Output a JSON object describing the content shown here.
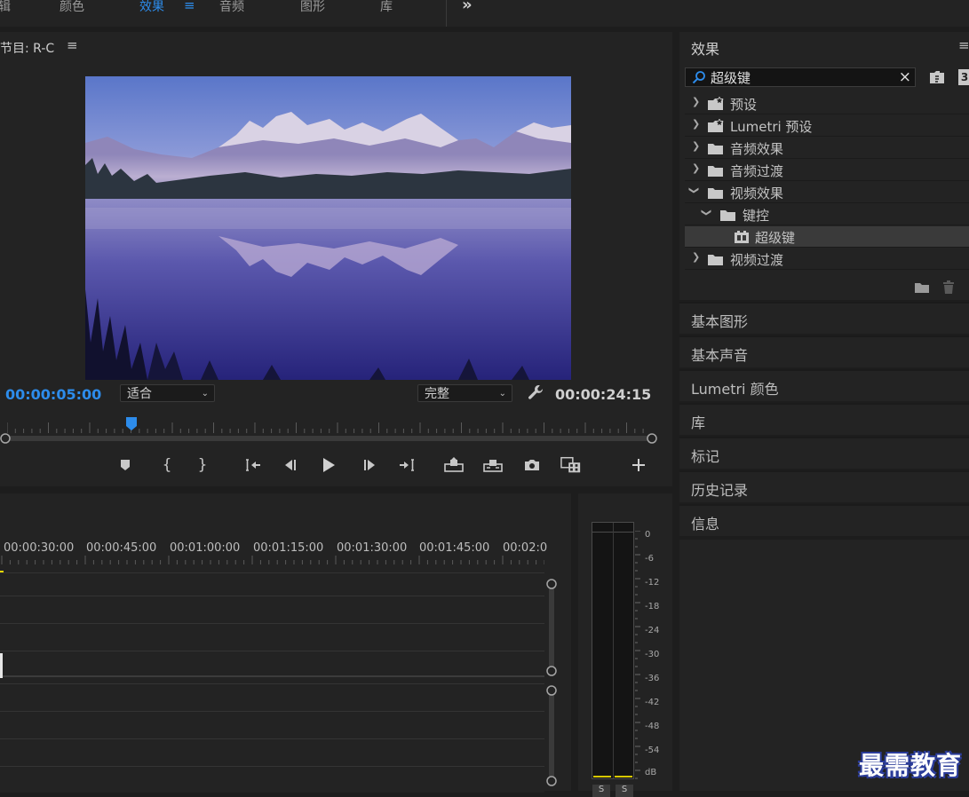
{
  "workspace_tabs": [
    {
      "label": "辑",
      "active": false
    },
    {
      "label": "颜色",
      "active": false
    },
    {
      "label": "效果",
      "active": true
    },
    {
      "label": "音频",
      "active": false
    },
    {
      "label": "图形",
      "active": false
    },
    {
      "label": "库",
      "active": false
    }
  ],
  "workspace_more": "»",
  "program_monitor": {
    "title": "节目: R-C",
    "menu": "≡",
    "current_timecode": "00:00:05:00",
    "zoom_value": "适合",
    "quality_value": "完整",
    "duration_timecode": "00:00:24:15",
    "playhead_fraction": 0.193
  },
  "transport_icons": [
    "add-marker-icon",
    "mark-in-icon",
    "mark-out-icon",
    "go-to-in-icon",
    "step-back-icon",
    "play-icon",
    "step-forward-icon",
    "go-to-out-icon",
    "lift-icon",
    "extract-icon",
    "export-frame-icon",
    "comparison-view-icon",
    "add-button-icon"
  ],
  "timeline": {
    "timecodes": [
      "00:00:30:00",
      "00:00:45:00",
      "00:01:00:00",
      "00:01:15:00",
      "00:01:30:00",
      "00:01:45:00",
      "00:02:0"
    ]
  },
  "audio_meter": {
    "db_labels": [
      "0",
      "-6",
      "-12",
      "-18",
      "-24",
      "-30",
      "-36",
      "-42",
      "-48",
      "-54",
      "dB"
    ],
    "channel_labels": [
      "S",
      "S"
    ]
  },
  "effects_panel": {
    "title": "效果",
    "menu": "≡",
    "search_value": "超级键",
    "clear_label": "×",
    "tree": [
      {
        "label": "预设",
        "level": 0,
        "expanded": false,
        "icon": "preset-folder-icon"
      },
      {
        "label": "Lumetri 预设",
        "level": 0,
        "expanded": false,
        "icon": "preset-folder-icon"
      },
      {
        "label": "音频效果",
        "level": 0,
        "expanded": false,
        "icon": "folder-icon"
      },
      {
        "label": "音频过渡",
        "level": 0,
        "expanded": false,
        "icon": "folder-icon"
      },
      {
        "label": "视频效果",
        "level": 0,
        "expanded": true,
        "icon": "folder-icon"
      },
      {
        "label": "键控",
        "level": 1,
        "expanded": true,
        "icon": "folder-icon"
      },
      {
        "label": "超级键",
        "level": 2,
        "expanded": null,
        "icon": "effect-icon",
        "selected": true
      },
      {
        "label": "视频过渡",
        "level": 0,
        "expanded": false,
        "icon": "folder-icon"
      }
    ]
  },
  "collapsed_panels": [
    "基本图形",
    "基本声音",
    "Lumetri 颜色",
    "库",
    "标记",
    "历史记录",
    "信息"
  ],
  "watermark": "最需教育",
  "colors": {
    "accent": "#2d8ceb",
    "panel_bg": "#232323",
    "app_bg": "#1d1d1d"
  }
}
